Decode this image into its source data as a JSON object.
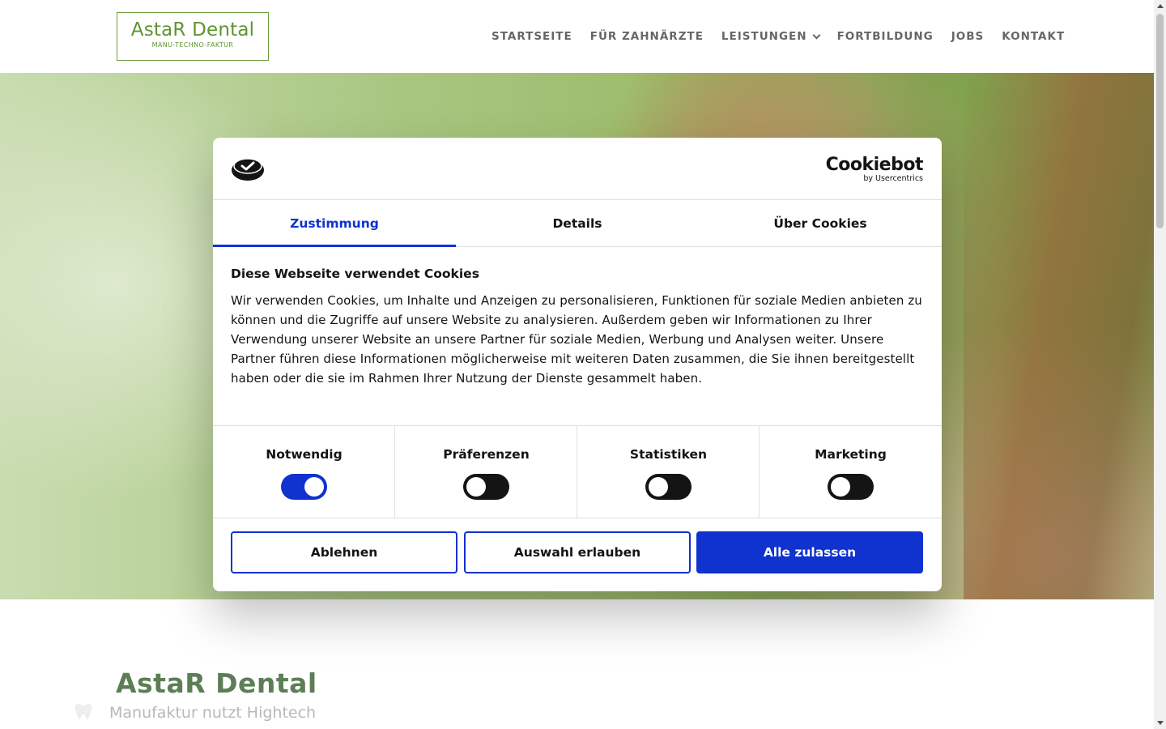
{
  "header": {
    "logo_title": "AstaR Dental",
    "logo_subtitle": "MANU-TECHNO-FAKTUR",
    "nav": [
      {
        "label": "STARTSEITE"
      },
      {
        "label": "FÜR ZAHNÄRZTE"
      },
      {
        "label": "LEISTUNGEN",
        "has_dropdown": true
      },
      {
        "label": "FORTBILDUNG"
      },
      {
        "label": "JOBS"
      },
      {
        "label": "KONTAKT"
      }
    ]
  },
  "content": {
    "title": "AstaR Dental",
    "subtitle": "Manufaktur nutzt Hightech"
  },
  "cookie_dialog": {
    "brand_name": "Cookiebot",
    "brand_by": "by Usercentrics",
    "tabs": [
      {
        "label": "Zustimmung",
        "active": true
      },
      {
        "label": "Details",
        "active": false
      },
      {
        "label": "Über Cookies",
        "active": false
      }
    ],
    "heading": "Diese Webseite verwendet Cookies",
    "body": "Wir verwenden Cookies, um Inhalte und Anzeigen zu personalisieren, Funktionen für soziale Medien anbieten zu können und die Zugriffe auf unsere Website zu analysieren. Außerdem geben wir Informationen zu Ihrer Verwendung unserer Website an unsere Partner für soziale Medien, Werbung und Analysen weiter. Unsere Partner führen diese Informationen möglicherweise mit weiteren Daten zusammen, die Sie ihnen bereitgestellt haben oder die sie im Rahmen Ihrer Nutzung der Dienste gesammelt haben.",
    "categories": [
      {
        "label": "Notwendig",
        "enabled": true
      },
      {
        "label": "Präferenzen",
        "enabled": false
      },
      {
        "label": "Statistiken",
        "enabled": false
      },
      {
        "label": "Marketing",
        "enabled": false
      }
    ],
    "buttons": {
      "decline": "Ablehnen",
      "allow_selection": "Auswahl erlauben",
      "allow_all": "Alle zulassen"
    }
  },
  "colors": {
    "accent_blue": "#1032cf",
    "brand_green": "#5e9431",
    "text_dark": "#141414"
  },
  "icons": {
    "cookiebot_logo": "cookiebot-logo-icon",
    "dropdown": "chevron-down-icon",
    "tooth": "tooth-icon"
  }
}
